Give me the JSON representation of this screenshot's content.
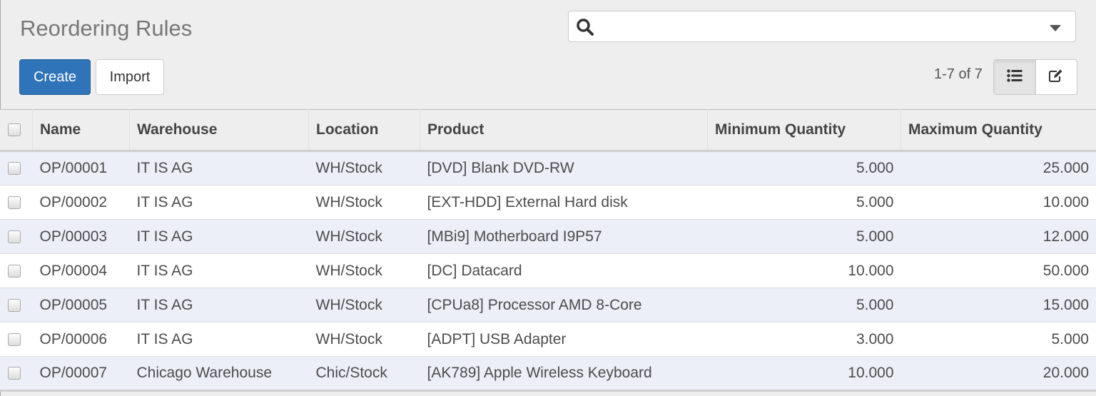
{
  "page": {
    "title": "Reordering Rules"
  },
  "search": {
    "placeholder": "",
    "value": "",
    "icon": "search-icon",
    "dropdown_icon": "caret-down-icon"
  },
  "toolbar": {
    "create_label": "Create",
    "import_label": "Import"
  },
  "pager": {
    "text": "1-7 of 7"
  },
  "view_switcher": {
    "views": [
      {
        "name": "list",
        "icon": "list-icon",
        "active": true
      },
      {
        "name": "form",
        "icon": "edit-icon",
        "active": false
      }
    ]
  },
  "colors": {
    "primary": "#2f73b9",
    "row_stripe": "#eceef8"
  },
  "table": {
    "columns": [
      "Name",
      "Warehouse",
      "Location",
      "Product",
      "Minimum Quantity",
      "Maximum Quantity"
    ],
    "rows": [
      {
        "name": "OP/00001",
        "warehouse": "IT IS AG",
        "location": "WH/Stock",
        "product": "[DVD] Blank DVD-RW",
        "min_qty": "5.000",
        "max_qty": "25.000"
      },
      {
        "name": "OP/00002",
        "warehouse": "IT IS AG",
        "location": "WH/Stock",
        "product": "[EXT-HDD] External Hard disk",
        "min_qty": "5.000",
        "max_qty": "10.000"
      },
      {
        "name": "OP/00003",
        "warehouse": "IT IS AG",
        "location": "WH/Stock",
        "product": "[MBi9] Motherboard I9P57",
        "min_qty": "5.000",
        "max_qty": "12.000"
      },
      {
        "name": "OP/00004",
        "warehouse": "IT IS AG",
        "location": "WH/Stock",
        "product": "[DC] Datacard",
        "min_qty": "10.000",
        "max_qty": "50.000"
      },
      {
        "name": "OP/00005",
        "warehouse": "IT IS AG",
        "location": "WH/Stock",
        "product": "[CPUa8] Processor AMD 8-Core",
        "min_qty": "5.000",
        "max_qty": "15.000"
      },
      {
        "name": "OP/00006",
        "warehouse": "IT IS AG",
        "location": "WH/Stock",
        "product": "[ADPT] USB Adapter",
        "min_qty": "3.000",
        "max_qty": "5.000"
      },
      {
        "name": "OP/00007",
        "warehouse": "Chicago Warehouse",
        "location": "Chic/Stock",
        "product": "[AK789] Apple Wireless Keyboard",
        "min_qty": "10.000",
        "max_qty": "20.000"
      }
    ]
  }
}
